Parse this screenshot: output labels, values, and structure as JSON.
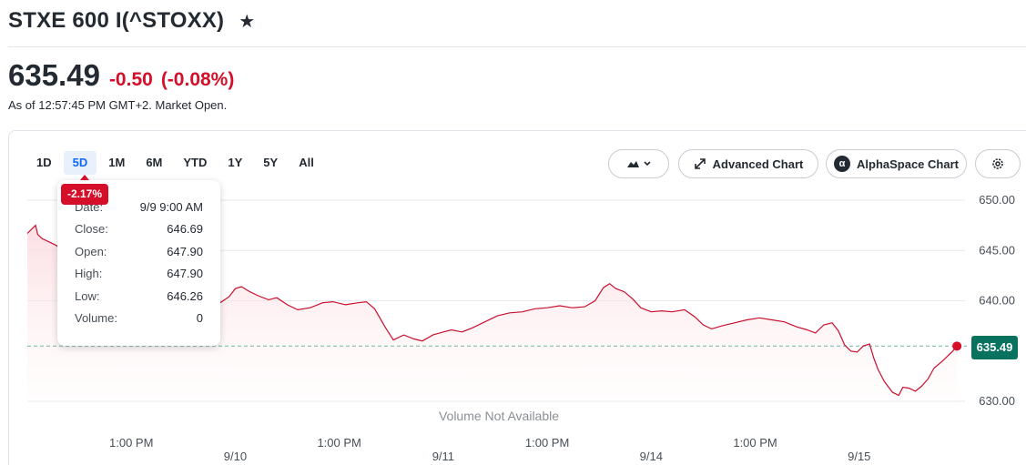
{
  "header": {
    "title": "STXE 600 I(^STOXX)",
    "watchlist_icon": "star-icon"
  },
  "quote": {
    "price": "635.49",
    "change": "-0.50",
    "change_percent": "(-0.08%)",
    "as_of": "As of 12:57:45 PM GMT+2. Market Open."
  },
  "toolbar": {
    "ranges": [
      {
        "label": "1D",
        "active": false
      },
      {
        "label": "5D",
        "active": true
      },
      {
        "label": "1M",
        "active": false
      },
      {
        "label": "6M",
        "active": false
      },
      {
        "label": "YTD",
        "active": false
      },
      {
        "label": "1Y",
        "active": false
      },
      {
        "label": "5Y",
        "active": false
      },
      {
        "label": "All",
        "active": false
      }
    ],
    "chart_type_icon": "mountain-chart-icon",
    "advanced_chart_label": "Advanced Chart",
    "alphaspace_label": "AlphaSpace Chart",
    "alphaspace_logo": "α",
    "settings_icon": "gear-icon"
  },
  "tooltip": {
    "badge": "-2.17%",
    "rows": [
      {
        "label": "Date:",
        "value": "9/9 9:00 AM"
      },
      {
        "label": "Close:",
        "value": "646.69"
      },
      {
        "label": "Open:",
        "value": "647.90"
      },
      {
        "label": "High:",
        "value": "647.90"
      },
      {
        "label": "Low:",
        "value": "646.26"
      },
      {
        "label": "Volume:",
        "value": "0"
      }
    ]
  },
  "colors": {
    "line": "#c8102e",
    "fill": "#fdecee",
    "grid": "#e6e9ec",
    "reference_line": "#7bbfae",
    "price_tag": "#09725f",
    "negative": "#d50f29",
    "active_tab": "#0f69ff"
  },
  "chart_data": {
    "type": "area",
    "ylim": [
      628,
      651
    ],
    "y_ticks": [
      {
        "value": 650,
        "label": "650.00"
      },
      {
        "value": 645,
        "label": "645.00"
      },
      {
        "value": 640,
        "label": "640.00"
      },
      {
        "value": 630,
        "label": "630.00"
      }
    ],
    "x_ticks": [
      {
        "label": "1:00 PM",
        "t": 0.5
      },
      {
        "label": "9/10",
        "t": 1.0
      },
      {
        "label": "1:00 PM",
        "t": 1.5
      },
      {
        "label": "9/11",
        "t": 2.0
      },
      {
        "label": "1:00 PM",
        "t": 2.5
      },
      {
        "label": "9/14",
        "t": 3.0
      },
      {
        "label": "1:00 PM",
        "t": 3.5
      },
      {
        "label": "9/15",
        "t": 4.0
      }
    ],
    "x_range": [
      0,
      4.5
    ],
    "current_value": 635.49,
    "current_label": "635.49",
    "volume_label": "Volume Not Available",
    "series": [
      {
        "points": [
          [
            0.0,
            646.7
          ],
          [
            0.02,
            647.1
          ],
          [
            0.04,
            647.5
          ],
          [
            0.05,
            646.6
          ],
          [
            0.07,
            646.2
          ],
          [
            0.1,
            645.9
          ],
          [
            0.14,
            645.5
          ],
          [
            0.18,
            644.6
          ],
          [
            0.22,
            643.8
          ],
          [
            0.27,
            642.7
          ],
          [
            0.31,
            641.8
          ],
          [
            0.35,
            641.0
          ],
          [
            0.4,
            640.3
          ],
          [
            0.44,
            639.7
          ],
          [
            0.48,
            639.5
          ],
          [
            0.53,
            639.8
          ],
          [
            0.58,
            640.1
          ],
          [
            0.63,
            639.9
          ],
          [
            0.68,
            640.6
          ],
          [
            0.72,
            640.8
          ],
          [
            0.77,
            640.3
          ],
          [
            0.83,
            639.9
          ],
          [
            0.87,
            639.4
          ],
          [
            0.92,
            639.7
          ],
          [
            0.97,
            640.4
          ],
          [
            1.0,
            641.2
          ],
          [
            1.03,
            641.4
          ],
          [
            1.07,
            640.9
          ],
          [
            1.11,
            640.5
          ],
          [
            1.16,
            640.1
          ],
          [
            1.2,
            640.3
          ],
          [
            1.25,
            639.6
          ],
          [
            1.3,
            639.1
          ],
          [
            1.36,
            639.3
          ],
          [
            1.42,
            639.8
          ],
          [
            1.47,
            639.9
          ],
          [
            1.53,
            639.6
          ],
          [
            1.59,
            639.8
          ],
          [
            1.63,
            639.9
          ],
          [
            1.67,
            639.2
          ],
          [
            1.72,
            637.4
          ],
          [
            1.76,
            636.1
          ],
          [
            1.81,
            636.6
          ],
          [
            1.86,
            636.2
          ],
          [
            1.9,
            636.0
          ],
          [
            1.95,
            636.6
          ],
          [
            2.0,
            636.9
          ],
          [
            2.04,
            637.1
          ],
          [
            2.09,
            636.9
          ],
          [
            2.14,
            637.3
          ],
          [
            2.2,
            637.9
          ],
          [
            2.26,
            638.5
          ],
          [
            2.32,
            638.8
          ],
          [
            2.38,
            638.9
          ],
          [
            2.44,
            639.2
          ],
          [
            2.5,
            639.3
          ],
          [
            2.56,
            639.5
          ],
          [
            2.62,
            639.3
          ],
          [
            2.68,
            639.4
          ],
          [
            2.73,
            640.0
          ],
          [
            2.77,
            641.3
          ],
          [
            2.8,
            641.7
          ],
          [
            2.83,
            641.2
          ],
          [
            2.87,
            640.9
          ],
          [
            2.91,
            640.2
          ],
          [
            2.95,
            639.3
          ],
          [
            3.0,
            638.9
          ],
          [
            3.05,
            639.0
          ],
          [
            3.1,
            638.9
          ],
          [
            3.16,
            639.1
          ],
          [
            3.21,
            638.4
          ],
          [
            3.25,
            637.6
          ],
          [
            3.29,
            637.2
          ],
          [
            3.34,
            637.5
          ],
          [
            3.4,
            637.8
          ],
          [
            3.46,
            638.1
          ],
          [
            3.52,
            638.3
          ],
          [
            3.58,
            638.1
          ],
          [
            3.64,
            637.9
          ],
          [
            3.7,
            637.4
          ],
          [
            3.75,
            637.1
          ],
          [
            3.79,
            636.8
          ],
          [
            3.83,
            637.6
          ],
          [
            3.87,
            637.8
          ],
          [
            3.9,
            637.0
          ],
          [
            3.93,
            635.6
          ],
          [
            3.96,
            635.0
          ],
          [
            3.99,
            634.9
          ],
          [
            4.02,
            635.5
          ],
          [
            4.05,
            635.7
          ],
          [
            4.07,
            634.3
          ],
          [
            4.09,
            633.2
          ],
          [
            4.12,
            632.0
          ],
          [
            4.16,
            630.9
          ],
          [
            4.19,
            630.6
          ],
          [
            4.21,
            631.4
          ],
          [
            4.24,
            631.3
          ],
          [
            4.27,
            631.0
          ],
          [
            4.3,
            631.5
          ],
          [
            4.33,
            632.2
          ],
          [
            4.36,
            633.3
          ],
          [
            4.4,
            634.0
          ],
          [
            4.43,
            634.6
          ],
          [
            4.45,
            635.0
          ],
          [
            4.47,
            635.49
          ]
        ]
      }
    ]
  }
}
